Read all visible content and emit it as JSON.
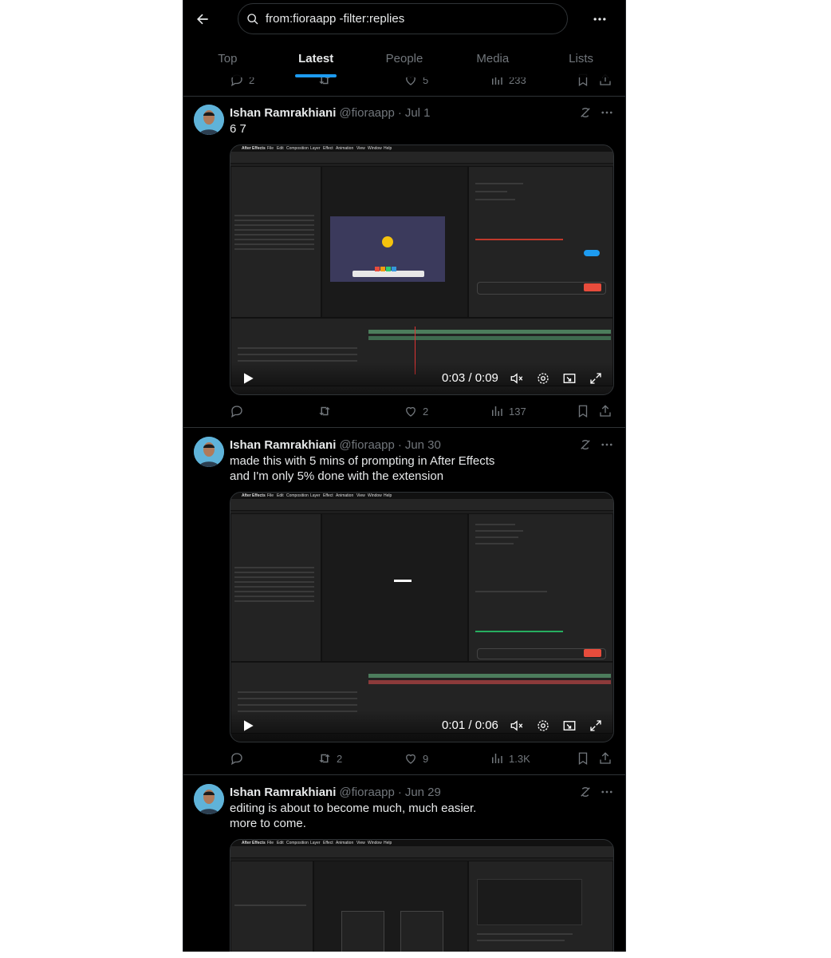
{
  "header": {
    "search_value": "from:fioraapp -filter:replies",
    "tabs": [
      {
        "label": "Top",
        "active": false
      },
      {
        "label": "Latest",
        "active": true
      },
      {
        "label": "People",
        "active": false
      },
      {
        "label": "Media",
        "active": false
      },
      {
        "label": "Lists",
        "active": false
      }
    ],
    "accent_color": "#1d9bf0"
  },
  "prev_tweet_actions": {
    "replies": "2",
    "retweets": "",
    "likes": "5",
    "views": "233"
  },
  "tweets": [
    {
      "author": "Ishan Ramrakhiani",
      "handle": "@fioraapp",
      "date": "Jul 1",
      "text": "6 7",
      "video_time": "0:03 / 0:09",
      "actions": {
        "replies": "",
        "retweets": "",
        "likes": "2",
        "views": "137"
      }
    },
    {
      "author": "Ishan Ramrakhiani",
      "handle": "@fioraapp",
      "date": "Jun 30",
      "text": "made this with 5 mins of prompting in After Effects\nand I'm only 5% done with the extension",
      "video_time": "0:01 / 0:06",
      "actions": {
        "replies": "",
        "retweets": "2",
        "likes": "9",
        "views": "1.3K"
      }
    },
    {
      "author": "Ishan Ramrakhiani",
      "handle": "@fioraapp",
      "date": "Jun 29",
      "text": "editing is about to become much, much easier.\nmore to come.",
      "video_time": "",
      "actions": {
        "replies": "",
        "retweets": "",
        "likes": "",
        "views": ""
      }
    }
  ],
  "screenshot_menu": [
    "After Effects",
    "File",
    "Edit",
    "Composition",
    "Layer",
    "Effect",
    "Animation",
    "View",
    "Window",
    "Help"
  ]
}
